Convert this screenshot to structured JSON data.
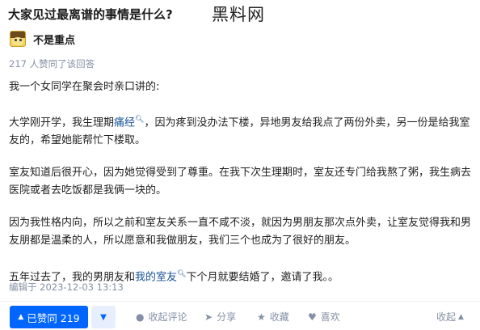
{
  "question": {
    "title": "大家见过最离谱的事情是什么?"
  },
  "watermark": "黑料网",
  "author": {
    "name": "不是重点"
  },
  "agree_info": "217 人赞同了该回答",
  "content": {
    "p1": "我一个女同学在聚会时亲口讲的:",
    "p2_a": "大学刚开学，我生理期",
    "p2_link": "痛经",
    "p2_b": "，因为疼到没办法下楼，异地男友给我点了两份外卖，另一份是给我室友的，希望她能帮忙下楼取。",
    "p3": "室友知道后很开心，因为她觉得受到了尊重。在我下次生理期时，室友还专门给我熬了粥，我生病去医院或者去吃饭都是我俩一块的。",
    "p4": "因为我性格内向，所以之前和室友关系一直不咸不淡，就因为男朋友那次点外卖，让室友觉得我和男友朋都是温柔的人，所以愿意和我做朋友，我们三个也成为了很好的朋友。",
    "p5_a": "五年过去了，我的男朋友和",
    "p5_link": "我的室友",
    "p5_b": "下个月就要结婚了，邀请了我。。"
  },
  "edit_time": "编辑于 2023-12-03 13:13",
  "actions": {
    "vote_up": "已赞同 219",
    "comment": "收起评论",
    "share": "分享",
    "favorite": "收藏",
    "like": "喜欢",
    "collapse": "收起"
  },
  "colors": {
    "accent": "#0066ff",
    "link": "#175199",
    "meta": "#8590a6"
  }
}
